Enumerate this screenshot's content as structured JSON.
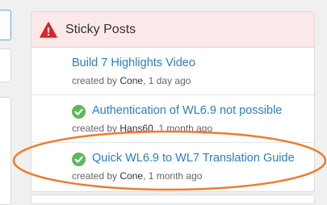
{
  "panel": {
    "title": "Sticky Posts",
    "icon": "warning-icon"
  },
  "posts": [
    {
      "title": "Build 7 Highlights Video",
      "meta_prefix": "created by ",
      "author": "Cone",
      "meta_suffix": ", 1 day ago",
      "status_icon": ""
    },
    {
      "title": "Authentication of WL6.9 not possible",
      "meta_prefix": "created by ",
      "author": "Hans60",
      "meta_suffix": ", 1 month ago",
      "status_icon": "check-circle-icon"
    },
    {
      "title": "Quick WL6.9 to WL7 Translation Guide",
      "meta_prefix": "created by ",
      "author": "Cone",
      "meta_suffix": ", 1 month ago",
      "status_icon": "check-circle-icon"
    }
  ],
  "colors": {
    "link": "#2a7fc1",
    "header_bg": "#fbe9e9",
    "warning": "#d9262b",
    "check": "#5cb85c",
    "highlight_oval": "#f07b2a"
  }
}
